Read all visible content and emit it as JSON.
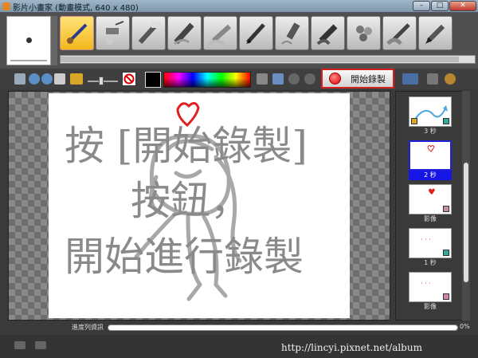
{
  "window": {
    "title": "影片小畫家 (動畫模式, 640 x 480)",
    "min": "–",
    "max": "□",
    "close": "✕"
  },
  "brush_tools": [
    {
      "name": "brush-tool-icon",
      "active": true
    },
    {
      "name": "airbrush-tool-icon"
    },
    {
      "name": "crayon-tool-icon"
    },
    {
      "name": "marker-tool-icon"
    },
    {
      "name": "chalk-tool-icon"
    },
    {
      "name": "pen-tool-icon"
    },
    {
      "name": "highlighter-tool-icon"
    },
    {
      "name": "eraser-tool-icon"
    },
    {
      "name": "stamp-tool-icon"
    },
    {
      "name": "watercolor-tool-icon"
    },
    {
      "name": "pencil-tool-icon"
    }
  ],
  "record_button": {
    "label": "開始錄製"
  },
  "canvas": {
    "caption_line1": "按 [開始錄製]",
    "caption_line2": "按鈕，",
    "caption_line3": "開始進行錄製"
  },
  "frames": [
    {
      "label": "3 秒",
      "selected": false
    },
    {
      "label": "2 秒",
      "selected": true
    },
    {
      "label": "影像",
      "selected": false
    },
    {
      "label": "1 秒",
      "selected": false
    },
    {
      "label": "影像",
      "selected": false
    }
  ],
  "progress": {
    "label": "進度列資訊",
    "percent": "0%",
    "value": 0
  },
  "footer": {
    "url": "http://lincyi.pixnet.net/album"
  },
  "colors": {
    "record_border": "#d52020",
    "selected_frame": "#1515e6",
    "active_tool": "#f2b81c"
  }
}
